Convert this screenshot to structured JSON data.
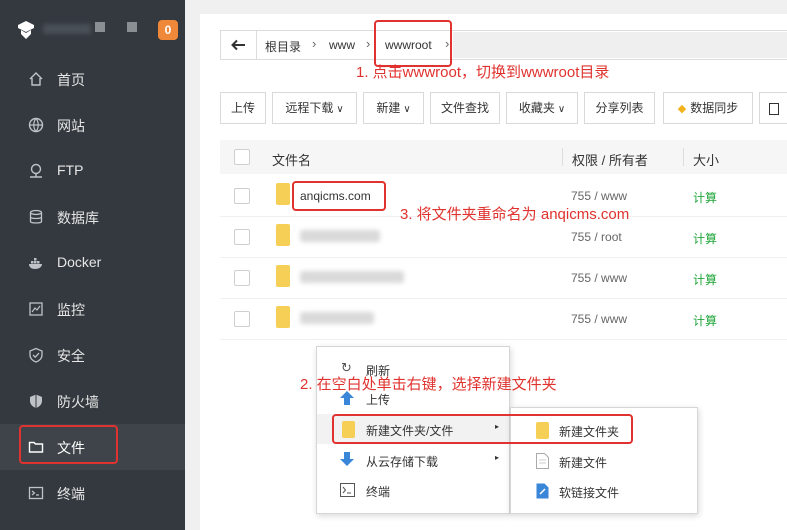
{
  "brand": {
    "badge": "0"
  },
  "sidebar": {
    "items": [
      {
        "label": "首页",
        "icon": "home-icon"
      },
      {
        "label": "网站",
        "icon": "globe-icon"
      },
      {
        "label": "FTP",
        "icon": "ftp-icon"
      },
      {
        "label": "数据库",
        "icon": "database-icon"
      },
      {
        "label": "Docker",
        "icon": "docker-icon"
      },
      {
        "label": "监控",
        "icon": "monitor-icon"
      },
      {
        "label": "安全",
        "icon": "shield-icon"
      },
      {
        "label": "防火墙",
        "icon": "firewall-icon"
      },
      {
        "label": "文件",
        "icon": "folder-icon"
      },
      {
        "label": "终端",
        "icon": "terminal-icon"
      }
    ],
    "active": "文件"
  },
  "breadcrumb": {
    "root": "根目录",
    "level1": "www",
    "level2": "wwwroot"
  },
  "toolbar": {
    "upload": "上传",
    "remote_download": "远程下载",
    "new": "新建",
    "file_search": "文件查找",
    "favorites": "收藏夹",
    "share_list": "分享列表",
    "data_sync": "数据同步"
  },
  "table": {
    "headers": {
      "name": "文件名",
      "perm": "权限 / 所有者",
      "size": "大小"
    },
    "rows": [
      {
        "name": "anqicms.com",
        "perm": "755 / www",
        "size": "计算"
      },
      {
        "name": "",
        "perm": "755 / root",
        "size": "计算"
      },
      {
        "name": "",
        "perm": "755 / www",
        "size": "计算"
      },
      {
        "name": "",
        "perm": "755 / www",
        "size": "计算"
      }
    ]
  },
  "context_menu": {
    "refresh": "刷新",
    "upload": "上传",
    "new_folder_file": "新建文件夹/文件",
    "download_cloud": "从云存储下载",
    "terminal": "终端"
  },
  "submenu": {
    "new_folder": "新建文件夹",
    "new_file": "新建文件",
    "soft_link": "软链接文件"
  },
  "annotations": {
    "step1": "1. 点击wwwroot，切换到wwwroot目录",
    "step2": "2. 在空白处单击右键，选择新建文件夹",
    "step3": "3. 将文件夹重命名为 anqicms.com"
  },
  "colors": {
    "sidebar_bg": "#33393f",
    "accent_green": "#20a53a",
    "annotation_red": "#e0322e",
    "badge_orange": "#f0883a"
  }
}
